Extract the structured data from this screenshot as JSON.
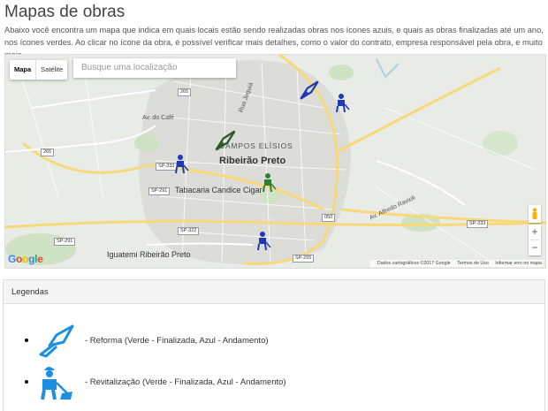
{
  "page": {
    "title": "Mapas de obras",
    "intro": "Abaixo você encontra um mapa que indica em quais locais estão sendo realizadas obras nos ícones azuis, e quais as obras finalizadas até um ano, nos ícones verdes. Ao clicar no ícone da obra, é possível verificar mais detalhes, como o valor do contrato, empresa responsável pela obra, e muito mais."
  },
  "map": {
    "type_map": "Mapa",
    "type_satellite": "Satélite",
    "search_placeholder": "Busque uma localização",
    "city": "Ribeirão Preto",
    "district": "CAMPOS ELÍSIOS",
    "poi_1": "Tabacaria Candice Cigar",
    "poi_2": "Iguatemi Ribeirão Preto",
    "street_cafe": "Av. do Café",
    "street_rua": "Rua Jequiá",
    "street_alfredo": "Av. Alfredo Ravioli",
    "shield_265a": "265",
    "shield_265b": "265",
    "shield_sp333": "SP-333",
    "shield_sp291": "SP-291",
    "shield_sp322": "SP-322",
    "shield_sp291b": "SP-291",
    "shield_050": "050",
    "shield_sp255": "SP-255",
    "shield_sp333b": "SP-333",
    "google": "Google",
    "footer_data": "Dados cartográficos ©2017 Google",
    "footer_terms": "Termos de Uso",
    "footer_report": "Informar erro no mapa",
    "zoom_in": "+",
    "zoom_out": "−"
  },
  "colors": {
    "blue_marker": "#1f3ab8",
    "green_marker": "#2e7d32",
    "legend_icon": "#1e8fe0"
  },
  "legend": {
    "header": "Legendas",
    "items": [
      {
        "icon": "trowel-icon",
        "text": "- Reforma (Verde - Finalizada, Azul - Andamento)"
      },
      {
        "icon": "worker-icon",
        "text": "- Revitalização (Verde - Finalizada, Azul - Andamento)"
      }
    ]
  }
}
